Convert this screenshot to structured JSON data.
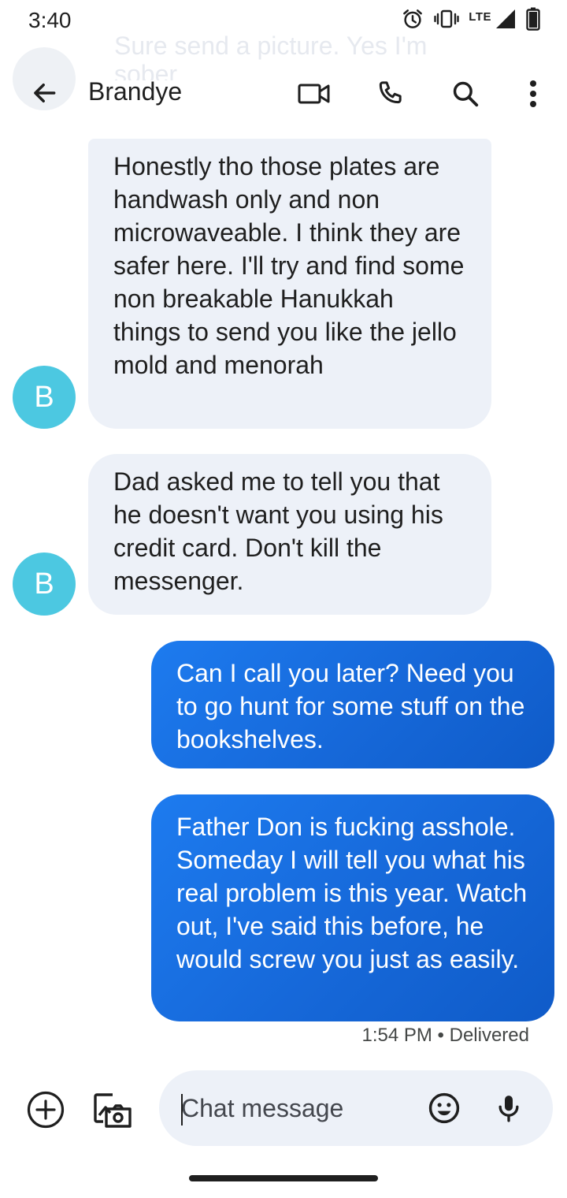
{
  "status_bar": {
    "time": "3:40",
    "network": "LTE",
    "battery_level": "57"
  },
  "ghost_preview": {
    "text": "Sure send a picture. Yes I'm sober"
  },
  "header": {
    "contact_name": "Brandye",
    "icons": [
      "back-arrow-icon",
      "video-call-icon",
      "phone-icon",
      "search-icon",
      "more-vert-icon"
    ]
  },
  "messages": [
    {
      "direction": "incoming",
      "sender_initial": "B",
      "text": "Honestly tho those plates are handwash only and non microwaveable. I think they are safer here. I'll try and find some non breakable Hanukkah things to send you like the jello mold and menorah"
    },
    {
      "direction": "incoming",
      "sender_initial": "B",
      "text": "Dad asked me to tell you that he doesn't want you using his credit card. Don't kill the messenger."
    },
    {
      "direction": "outgoing",
      "text": "Can I call you later? Need you to go hunt for some stuff on the bookshelves."
    },
    {
      "direction": "outgoing",
      "text": "Father Don is fucking asshole. Someday I will tell you what his real problem is this year. Watch out, I've said this before, he would screw you just as easily."
    }
  ],
  "last_message_status": "1:54 PM • Delivered",
  "compose": {
    "placeholder": "Chat message",
    "value": ""
  },
  "colors": {
    "avatar": "#4cc8e1",
    "incoming_bubble": "#edf1f8",
    "outgoing_bubble": "#1a73e8",
    "text": "#1f1f1f"
  }
}
